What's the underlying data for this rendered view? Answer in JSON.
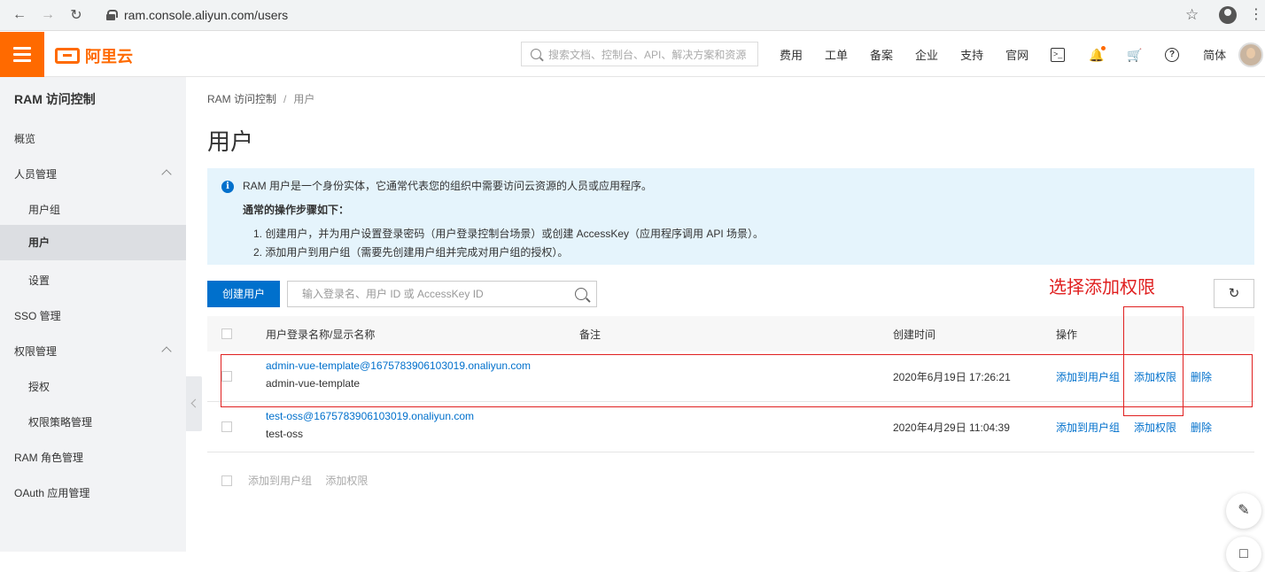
{
  "browser": {
    "url": "ram.console.aliyun.com/users"
  },
  "topnav": {
    "logo_text": "阿里云",
    "search_placeholder": "搜索文档、控制台、API、解决方案和资源",
    "links": [
      "费用",
      "工单",
      "备案",
      "企业",
      "支持",
      "官网"
    ],
    "lang": "简体"
  },
  "sidebar": {
    "title": "RAM 访问控制",
    "items": [
      {
        "label": "概览"
      },
      {
        "label": "人员管理"
      },
      {
        "label": "用户组"
      },
      {
        "label": "用户"
      },
      {
        "label": "设置"
      },
      {
        "label": "SSO 管理"
      },
      {
        "label": "权限管理"
      },
      {
        "label": "授权"
      },
      {
        "label": "权限策略管理"
      },
      {
        "label": "RAM 角色管理"
      },
      {
        "label": "OAuth 应用管理"
      }
    ]
  },
  "breadcrumb": {
    "root": "RAM 访问控制",
    "separator": "/",
    "current": "用户"
  },
  "page_title": "用户",
  "info": {
    "line1": "RAM 用户是一个身份实体，它通常代表您的组织中需要访问云资源的人员或应用程序。",
    "heading": "通常的操作步骤如下：",
    "step1": "1. 创建用户，并为用户设置登录密码（用户登录控制台场景）或创建 AccessKey（应用程序调用 API 场景）。",
    "step2": "2. 添加用户到用户组（需要先创建用户组并完成对用户组的授权）。"
  },
  "toolbar": {
    "create_label": "创建用户",
    "search_placeholder": "输入登录名、用户 ID 或 AccessKey ID"
  },
  "annotation": "选择添加权限",
  "table": {
    "columns": [
      "用户登录名称/显示名称",
      "备注",
      "创建时间",
      "操作"
    ],
    "rows": [
      {
        "login": "admin-vue-template@1675783906103019.onaliyun.com",
        "display": "admin-vue-template",
        "note": "",
        "created": "2020年6月19日 17:26:21",
        "actions": [
          "添加到用户组",
          "添加权限",
          "删除"
        ]
      },
      {
        "login": "test-oss@1675783906103019.onaliyun.com",
        "display": "test-oss",
        "note": "",
        "created": "2020年4月29日 11:04:39",
        "actions": [
          "添加到用户组",
          "添加权限",
          "删除"
        ]
      }
    ]
  },
  "bulk_actions": [
    "添加到用户组",
    "添加权限"
  ],
  "colors": {
    "brand": "#ff6a00",
    "primary": "#0070cc",
    "highlight": "#e02020",
    "info_bg": "#e5f4fc"
  }
}
